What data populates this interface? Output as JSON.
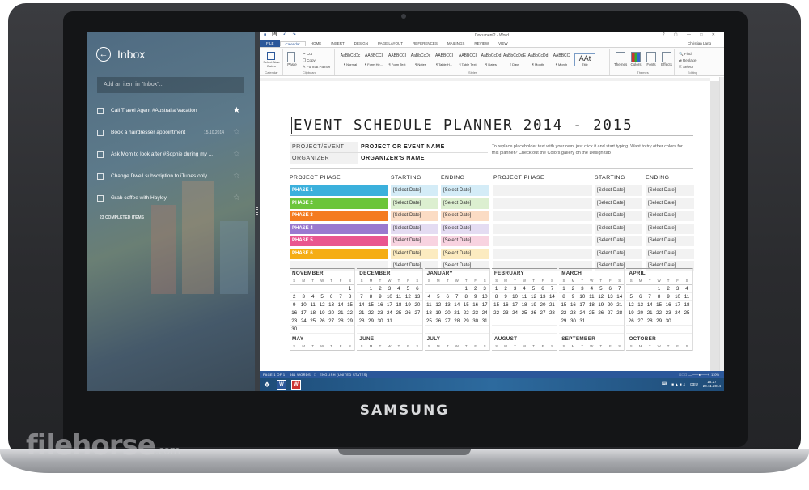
{
  "device": {
    "brand": "SAMSUNG",
    "watermark": "filehorse",
    "watermark_suffix": ".com"
  },
  "wunderlist": {
    "title": "Inbox",
    "add_placeholder": "Add an item in \"Inbox\"...",
    "items": [
      {
        "text": "Call Travel Agent #Australia Vacation",
        "date": "",
        "starred": true
      },
      {
        "text": "Book a hairdresser appointment",
        "date": "15.10.2014",
        "starred": false
      },
      {
        "text": "Ask Mom to look after #Sophie during my ...",
        "date": "",
        "starred": false
      },
      {
        "text": "Change Dwell subscription to iTunes only",
        "date": "",
        "starred": false
      },
      {
        "text": "Grab coffee with Hayley",
        "date": "",
        "starred": false
      }
    ],
    "completed_label": "23 COMPLETED ITEMS"
  },
  "word": {
    "doc_title": "Document2 - Word",
    "user": "Christian Lang",
    "tabs": [
      "FILE",
      "Calendar",
      "HOME",
      "INSERT",
      "DESIGN",
      "PAGE LAYOUT",
      "REFERENCES",
      "MAILINGS",
      "REVIEW",
      "VIEW"
    ],
    "ribbon": {
      "calendar_group": "Calendar",
      "select_dates": "Select New Dates",
      "clipboard_group": "Clipboard",
      "paste": "Paste",
      "cut": "Cut",
      "copy": "Copy",
      "format_painter": "Format Painter",
      "styles_group": "Styles",
      "styles": [
        {
          "preview": "AaBbCcDc",
          "name": "¶ Normal"
        },
        {
          "preview": "AABBCCI",
          "name": "¶ Form He..."
        },
        {
          "preview": "AABBCCI",
          "name": "¶ Form Text"
        },
        {
          "preview": "AaBbCcDc",
          "name": "¶ Notes"
        },
        {
          "preview": "AABBCCI",
          "name": "¶ Table H..."
        },
        {
          "preview": "AABBCCI",
          "name": "¶ Table Text"
        },
        {
          "preview": "AaBbCcDd",
          "name": "¶ Dates"
        },
        {
          "preview": "AaBbCcDdE",
          "name": "¶ Days"
        },
        {
          "preview": "AaBbCcDd",
          "name": "¶ Month"
        },
        {
          "preview": "AABBCC",
          "name": "¶ Month"
        },
        {
          "preview": "AAt",
          "name": "Title"
        }
      ],
      "themes_group": "Themes",
      "themes": [
        "Themes",
        "Colors",
        "Fonts",
        "Effects"
      ],
      "editing_group": "Editing",
      "find": "Find",
      "replace": "Replace",
      "select": "Select"
    },
    "document": {
      "title": "EVENT SCHEDULE PLANNER 2014 - 2015",
      "info": [
        {
          "label": "PROJECT/EVENT",
          "value": "PROJECT OR EVENT NAME"
        },
        {
          "label": "ORGANIZER",
          "value": "ORGANIZER'S NAME"
        }
      ],
      "hint": "To replace placeholder text with your own, just click it and start typing. Want to try other colors for this planner? Check out the Colors gallery on the Design tab",
      "phase_headers": [
        "PROJECT PHASE",
        "STARTING",
        "ENDING",
        "PROJECT PHASE",
        "STARTING",
        "ENDING"
      ],
      "select_date": "[Select Date]",
      "phases": [
        {
          "name": "PHASE 1",
          "color": "#3bb0dc",
          "tint": "#d4ecf7"
        },
        {
          "name": "PHASE 2",
          "color": "#6cc53a",
          "tint": "#dcefd0"
        },
        {
          "name": "PHASE 3",
          "color": "#f47b20",
          "tint": "#fbdcc4"
        },
        {
          "name": "PHASE 4",
          "color": "#9a79cf",
          "tint": "#e4dcf2"
        },
        {
          "name": "PHASE 5",
          "color": "#e9568f",
          "tint": "#f8d3e0"
        },
        {
          "name": "PHASE 6",
          "color": "#f5ad14",
          "tint": "#fcebc0"
        },
        {
          "name": "",
          "color": "",
          "tint": "#f2f2f2"
        }
      ],
      "day_letters": [
        "S",
        "M",
        "T",
        "W",
        "T",
        "F",
        "S"
      ],
      "months": [
        {
          "name": "NOVEMBER",
          "weeks": [
            [
              "",
              "",
              "",
              "",
              "",
              "",
              "1"
            ],
            [
              "2",
              "3",
              "4",
              "5",
              "6",
              "7",
              "8"
            ],
            [
              "9",
              "10",
              "11",
              "12",
              "13",
              "14",
              "15"
            ],
            [
              "16",
              "17",
              "18",
              "19",
              "20",
              "21",
              "22"
            ],
            [
              "23",
              "24",
              "25",
              "26",
              "27",
              "28",
              "29"
            ],
            [
              "30",
              "",
              "",
              "",
              "",
              "",
              ""
            ]
          ]
        },
        {
          "name": "DECEMBER",
          "weeks": [
            [
              "",
              "1",
              "2",
              "3",
              "4",
              "5",
              "6"
            ],
            [
              "7",
              "8",
              "9",
              "10",
              "11",
              "12",
              "13"
            ],
            [
              "14",
              "15",
              "16",
              "17",
              "18",
              "19",
              "20"
            ],
            [
              "21",
              "22",
              "23",
              "24",
              "25",
              "26",
              "27"
            ],
            [
              "28",
              "29",
              "30",
              "31",
              "",
              "",
              ""
            ],
            [
              "",
              "",
              "",
              "",
              "",
              "",
              ""
            ]
          ]
        },
        {
          "name": "JANUARY",
          "weeks": [
            [
              "",
              "",
              "",
              "",
              "1",
              "2",
              "3"
            ],
            [
              "4",
              "5",
              "6",
              "7",
              "8",
              "9",
              "10"
            ],
            [
              "11",
              "12",
              "13",
              "14",
              "15",
              "16",
              "17"
            ],
            [
              "18",
              "19",
              "20",
              "21",
              "22",
              "23",
              "24"
            ],
            [
              "25",
              "26",
              "27",
              "28",
              "29",
              "30",
              "31"
            ],
            [
              "",
              "",
              "",
              "",
              "",
              "",
              ""
            ]
          ]
        },
        {
          "name": "FEBRUARY",
          "weeks": [
            [
              "1",
              "2",
              "3",
              "4",
              "5",
              "6",
              "7"
            ],
            [
              "8",
              "9",
              "10",
              "11",
              "12",
              "13",
              "14"
            ],
            [
              "15",
              "16",
              "17",
              "18",
              "19",
              "20",
              "21"
            ],
            [
              "22",
              "23",
              "24",
              "25",
              "26",
              "27",
              "28"
            ],
            [
              "",
              "",
              "",
              "",
              "",
              "",
              ""
            ],
            [
              "",
              "",
              "",
              "",
              "",
              "",
              ""
            ]
          ]
        },
        {
          "name": "MARCH",
          "weeks": [
            [
              "1",
              "2",
              "3",
              "4",
              "5",
              "6",
              "7"
            ],
            [
              "8",
              "9",
              "10",
              "11",
              "12",
              "13",
              "14"
            ],
            [
              "15",
              "16",
              "17",
              "18",
              "19",
              "20",
              "21"
            ],
            [
              "22",
              "23",
              "24",
              "25",
              "26",
              "27",
              "28"
            ],
            [
              "29",
              "30",
              "31",
              "",
              "",
              "",
              ""
            ],
            [
              "",
              "",
              "",
              "",
              "",
              "",
              ""
            ]
          ]
        },
        {
          "name": "APRIL",
          "weeks": [
            [
              "",
              "",
              "",
              "1",
              "2",
              "3",
              "4"
            ],
            [
              "5",
              "6",
              "7",
              "8",
              "9",
              "10",
              "11"
            ],
            [
              "12",
              "13",
              "14",
              "15",
              "16",
              "17",
              "18"
            ],
            [
              "19",
              "20",
              "21",
              "22",
              "23",
              "24",
              "25"
            ],
            [
              "26",
              "27",
              "28",
              "29",
              "30",
              "",
              ""
            ],
            [
              "",
              "",
              "",
              "",
              "",
              "",
              ""
            ]
          ]
        }
      ],
      "next_months": [
        "MAY",
        "JUNE",
        "JULY",
        "AUGUST",
        "SEPTEMBER",
        "OCTOBER"
      ]
    },
    "status": {
      "page": "PAGE 1 OF 1",
      "words": "561 WORDS",
      "language": "ENGLISH (UNITED STATES)",
      "zoom": "110%"
    },
    "taskbar": {
      "lang": "DEU",
      "time": "15:27",
      "date": "20.11.2014"
    }
  }
}
